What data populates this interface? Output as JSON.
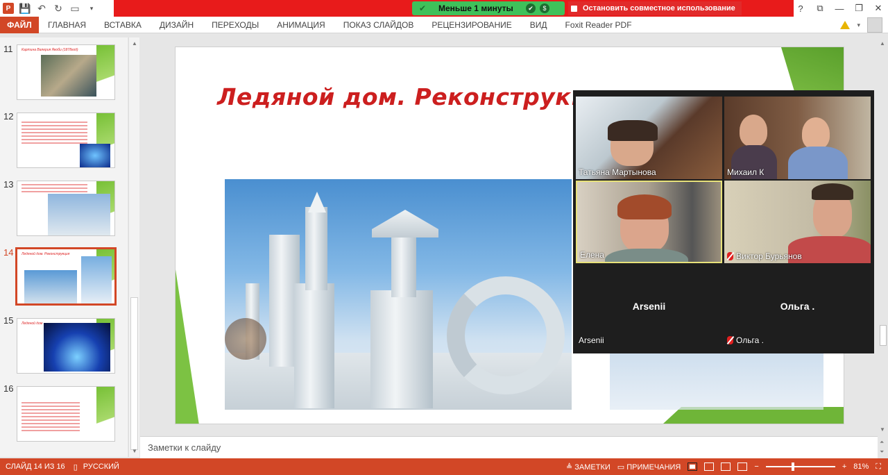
{
  "app": {
    "logo": "P",
    "share_timer": "Меньше 1 минуты",
    "stop_share": "Остановить совместное использование"
  },
  "ribbon": {
    "tabs": [
      "ФАЙЛ",
      "ГЛАВНАЯ",
      "ВСТАВКА",
      "ДИЗАЙН",
      "ПЕРЕХОДЫ",
      "АНИМАЦИЯ",
      "ПОКАЗ СЛАЙДОВ",
      "РЕЦЕНЗИРОВАНИЕ",
      "ВИД",
      "Foxit Reader PDF"
    ]
  },
  "thumbnails": {
    "numbers": [
      "11",
      "12",
      "13",
      "14",
      "15",
      "16"
    ],
    "titles": [
      "Картина Валерия Якоби (1878год)",
      "",
      "",
      "Ледяной дом. Реконструкция",
      "Ледяной дом",
      ""
    ],
    "active": "14"
  },
  "slide": {
    "title": "Ледяной дом. Реконструкция"
  },
  "zoom": {
    "participants": [
      {
        "name": "Татьяна Мартынова",
        "muted": false
      },
      {
        "name": "Михаил К",
        "muted": false
      },
      {
        "name": "Елена",
        "muted": false,
        "speaking": true
      },
      {
        "name": "Виктор Бурьянов",
        "muted": true
      },
      {
        "name": "Arsenii",
        "label": "Arsenii",
        "muted": false
      },
      {
        "name": "Ольга .",
        "label": "Ольга .",
        "muted": true
      }
    ]
  },
  "notes": {
    "placeholder": "Заметки к слайду"
  },
  "status": {
    "slide_info": "СЛАЙД 14 ИЗ 16",
    "language": "РУССКИЙ",
    "notes_btn": "ЗАМЕТКИ",
    "comments_btn": "ПРИМЕЧАНИЯ",
    "zoom_minus": "−",
    "zoom_plus": "+",
    "zoom_level": "81%",
    "zoom_fraction": 0.81
  },
  "colors": {
    "accent": "#d24726",
    "share_red": "#e81b1b",
    "timer_green": "#3fc15a",
    "slide_title": "#cc1f1f"
  }
}
